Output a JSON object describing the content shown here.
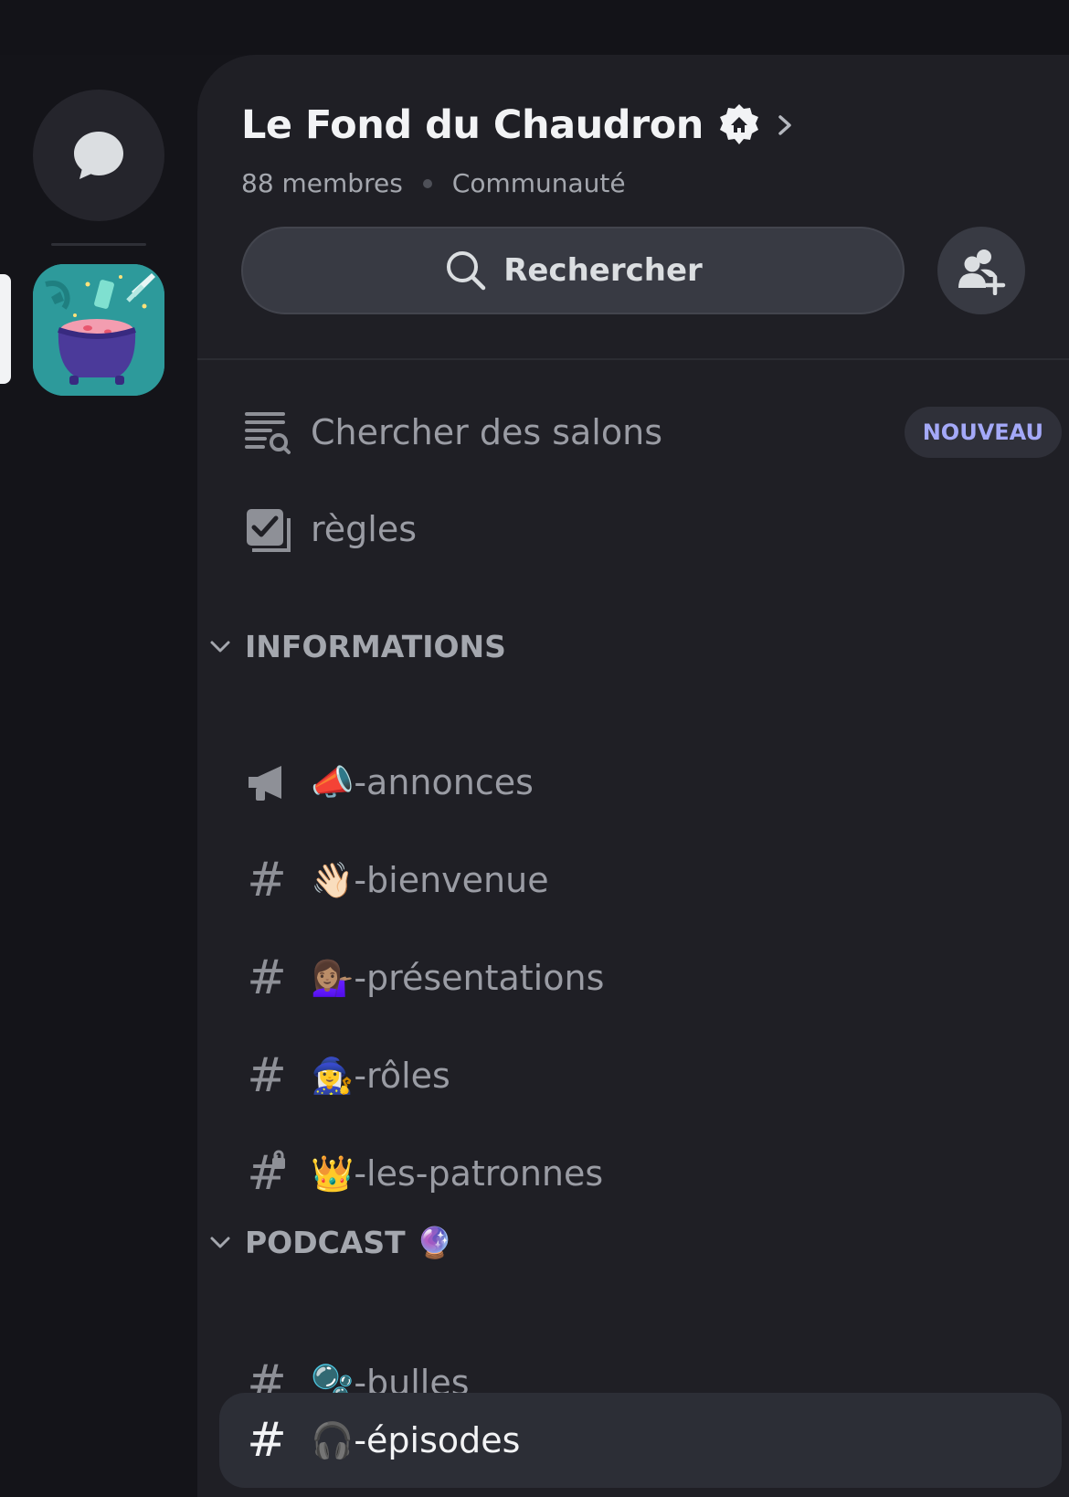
{
  "guild": {
    "name": "Le Fond du Chaudron",
    "members": "88 membres",
    "type": "Communauté"
  },
  "search": {
    "label": "Rechercher"
  },
  "browse": {
    "label": "Chercher des salons",
    "badge": "NOUVEAU"
  },
  "rules": {
    "label": "règles"
  },
  "categories": [
    {
      "name": "INFORMATIONS",
      "channels": [
        {
          "emoji": "📣",
          "label": "-annonces",
          "icon": "announcement-icon"
        },
        {
          "emoji": "👋🏻",
          "label": "-bienvenue",
          "icon": "hash-icon"
        },
        {
          "emoji": "💁🏽‍♀️",
          "label": "-présentations",
          "icon": "hash-icon"
        },
        {
          "emoji": "🧙‍♀️",
          "label": "-rôles",
          "icon": "hash-icon"
        },
        {
          "emoji": "👑",
          "label": "-les-patronnes",
          "icon": "locked-hash-icon"
        }
      ]
    },
    {
      "name": "PODCAST 🔮",
      "channels": [
        {
          "emoji": "🫧",
          "label": "-bulles",
          "icon": "hash-icon"
        },
        {
          "emoji": "🎧",
          "label": "-épisodes",
          "icon": "hash-icon",
          "active": true
        }
      ]
    }
  ],
  "colors": {
    "accent_badge": "#a4a9f8",
    "panel_bg": "#1f1f25",
    "rail_bg": "#141419"
  }
}
